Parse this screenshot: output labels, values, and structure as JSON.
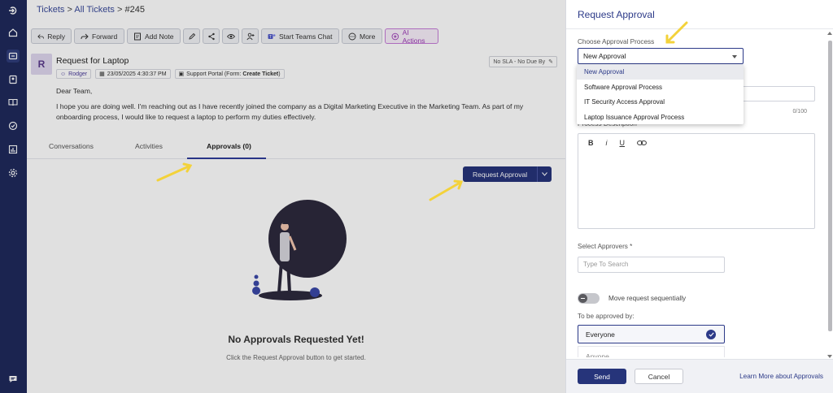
{
  "nav": {
    "items": [
      "logout-icon",
      "home-icon",
      "tickets-icon",
      "contacts-icon",
      "knowledge-icon",
      "tasks-icon",
      "reports-icon",
      "settings-icon"
    ],
    "chat_icon": "chat-icon"
  },
  "breadcrumb": {
    "root": "Tickets",
    "list": "All Tickets",
    "current": "#245",
    "sep": ">"
  },
  "toolbar": {
    "reply": "Reply",
    "forward": "Forward",
    "add_note": "Add Note",
    "teams": "Start Teams Chat",
    "more": "More",
    "ai": "AI Actions"
  },
  "ticket": {
    "avatar": "R",
    "title": "Request for Laptop",
    "requester": "Rodger",
    "date": "23/05/2025 4:30:37 PM",
    "source": "Support Portal (Form: ",
    "form": "Create Ticket",
    "source_end": ")",
    "sla": "No SLA - No Due By",
    "greeting": "Dear Team,",
    "body": "I hope you are doing well. I'm reaching out as I have recently joined the company as a Digital Marketing Executive in the Marketing Team. As part of my onboarding process, I would like to request a laptop to perform my duties effectively."
  },
  "tabs": {
    "conversations": "Conversations",
    "activities": "Activities",
    "approvals": "Approvals (0)"
  },
  "approvals": {
    "request_button": "Request Approval",
    "empty_title": "No Approvals Requested Yet!",
    "empty_subtitle": "Click the Request Approval button to get started."
  },
  "drawer": {
    "title": "Request Approval",
    "process_label": "Choose Approval Process",
    "process_value": "New Approval",
    "process_options": [
      "New Approval",
      "Software Approval Process",
      "IT Security Access Approval",
      "Laptop Issuance Approval Process"
    ],
    "counter": "0/100",
    "description_label": "Process Description",
    "editor_bold": "B",
    "editor_italic": "i",
    "editor_underline": "U",
    "approvers_label": "Select Approvers *",
    "approvers_placeholder": "Type To Search",
    "toggle_label": "Move request sequentially",
    "approved_by_label": "To be approved by:",
    "approved_by_value": "Everyone",
    "approved_by_next": "Anyone",
    "send": "Send",
    "cancel": "Cancel",
    "learn_more": "Learn More about Approvals"
  },
  "colors": {
    "nav_bg": "#1f2a5c",
    "accent": "#26347a",
    "ai_purple": "#9c3cb6",
    "annotation_arrow": "#f3d23a"
  }
}
